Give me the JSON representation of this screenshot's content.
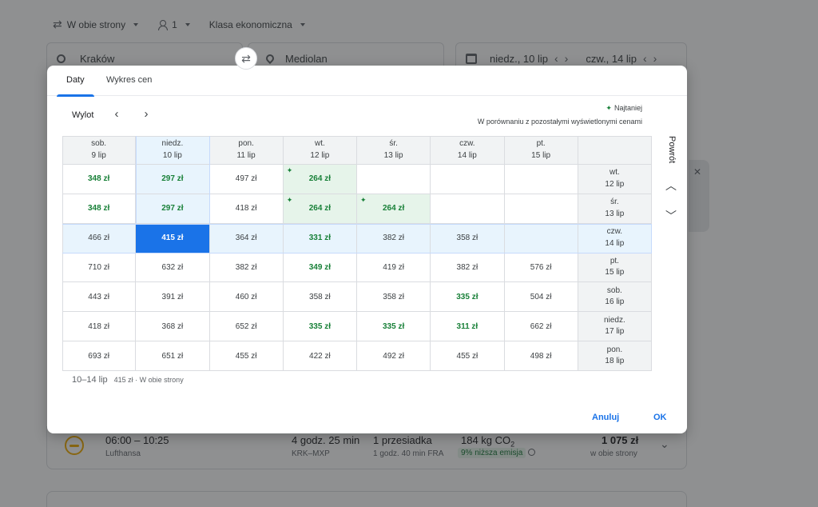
{
  "search": {
    "trip_type": "W obie strony",
    "passengers": "1",
    "cabin_class": "Klasa ekonomiczna",
    "origin": "Kraków",
    "destination": "Mediolan",
    "depart_date": "niedz., 10 lip",
    "return_date": "czw., 14 lip"
  },
  "dialog": {
    "tabs": [
      "Daty",
      "Wykres cen"
    ],
    "active_tab": "Daty",
    "departure_label": "Wylot",
    "return_label": "Powrót",
    "legend_cheapest": "Najtaniej",
    "legend_compare": "W porównaniu z pozostałymi wyświetlonymi cenami",
    "departure_columns": [
      {
        "day": "sob.",
        "date": "9 lip"
      },
      {
        "day": "niedz.",
        "date": "10 lip"
      },
      {
        "day": "pon.",
        "date": "11 lip"
      },
      {
        "day": "wt.",
        "date": "12 lip"
      },
      {
        "day": "śr.",
        "date": "13 lip"
      },
      {
        "day": "czw.",
        "date": "14 lip"
      },
      {
        "day": "pt.",
        "date": "15 lip"
      }
    ],
    "return_rows": [
      {
        "day": "wt.",
        "date": "12 lip"
      },
      {
        "day": "śr.",
        "date": "13 lip"
      },
      {
        "day": "czw.",
        "date": "14 lip"
      },
      {
        "day": "pt.",
        "date": "15 lip"
      },
      {
        "day": "sob.",
        "date": "16 lip"
      },
      {
        "day": "niedz.",
        "date": "17 lip"
      },
      {
        "day": "pon.",
        "date": "18 lip"
      }
    ],
    "prices": [
      [
        "348 zł",
        "297 zł",
        "497 zł",
        "264 zł",
        "",
        "",
        ""
      ],
      [
        "348 zł",
        "297 zł",
        "418 zł",
        "264 zł",
        "264 zł",
        "",
        ""
      ],
      [
        "466 zł",
        "415 zł",
        "364 zł",
        "331 zł",
        "382 zł",
        "358 zł",
        ""
      ],
      [
        "710 zł",
        "632 zł",
        "382 zł",
        "349 zł",
        "419 zł",
        "382 zł",
        "576 zł"
      ],
      [
        "443 zł",
        "391 zł",
        "460 zł",
        "358 zł",
        "358 zł",
        "335 zł",
        "504 zł"
      ],
      [
        "418 zł",
        "368 zł",
        "652 zł",
        "335 zł",
        "335 zł",
        "311 zł",
        "662 zł"
      ],
      [
        "693 zł",
        "651 zł",
        "455 zł",
        "422 zł",
        "492 zł",
        "455 zł",
        "498 zł"
      ]
    ],
    "cheap_cells": [
      [
        0,
        0
      ],
      [
        0,
        1
      ],
      [
        0,
        3
      ],
      [
        1,
        0
      ],
      [
        1,
        1
      ],
      [
        1,
        3
      ],
      [
        1,
        4
      ],
      [
        2,
        3
      ],
      [
        3,
        3
      ],
      [
        4,
        5
      ],
      [
        5,
        3
      ],
      [
        5,
        4
      ],
      [
        5,
        5
      ]
    ],
    "cheapest_cells": [
      [
        0,
        3
      ],
      [
        1,
        3
      ],
      [
        1,
        4
      ]
    ],
    "selected_cell": [
      2,
      1
    ],
    "summary_dates": "10–14 lip",
    "summary_price": "415 zł · W obie strony",
    "cancel_label": "Anuluj",
    "ok_label": "OK"
  },
  "flight": {
    "times": "06:00 – 10:25",
    "airline": "Lufthansa",
    "duration": "4 godz. 25 min",
    "route": "KRK–MXP",
    "stops": "1 przesiadka",
    "stop_detail": "1 godz. 40 min FRA",
    "co2": "184 kg CO",
    "co2_sub": "2",
    "emissions": "9% niższa emisja",
    "price": "1 075 zł",
    "price_note": "w obie strony"
  },
  "colors": {
    "accent": "#1a73e8",
    "cheap_green": "#188038",
    "selected_bg": "#1a73e8"
  }
}
